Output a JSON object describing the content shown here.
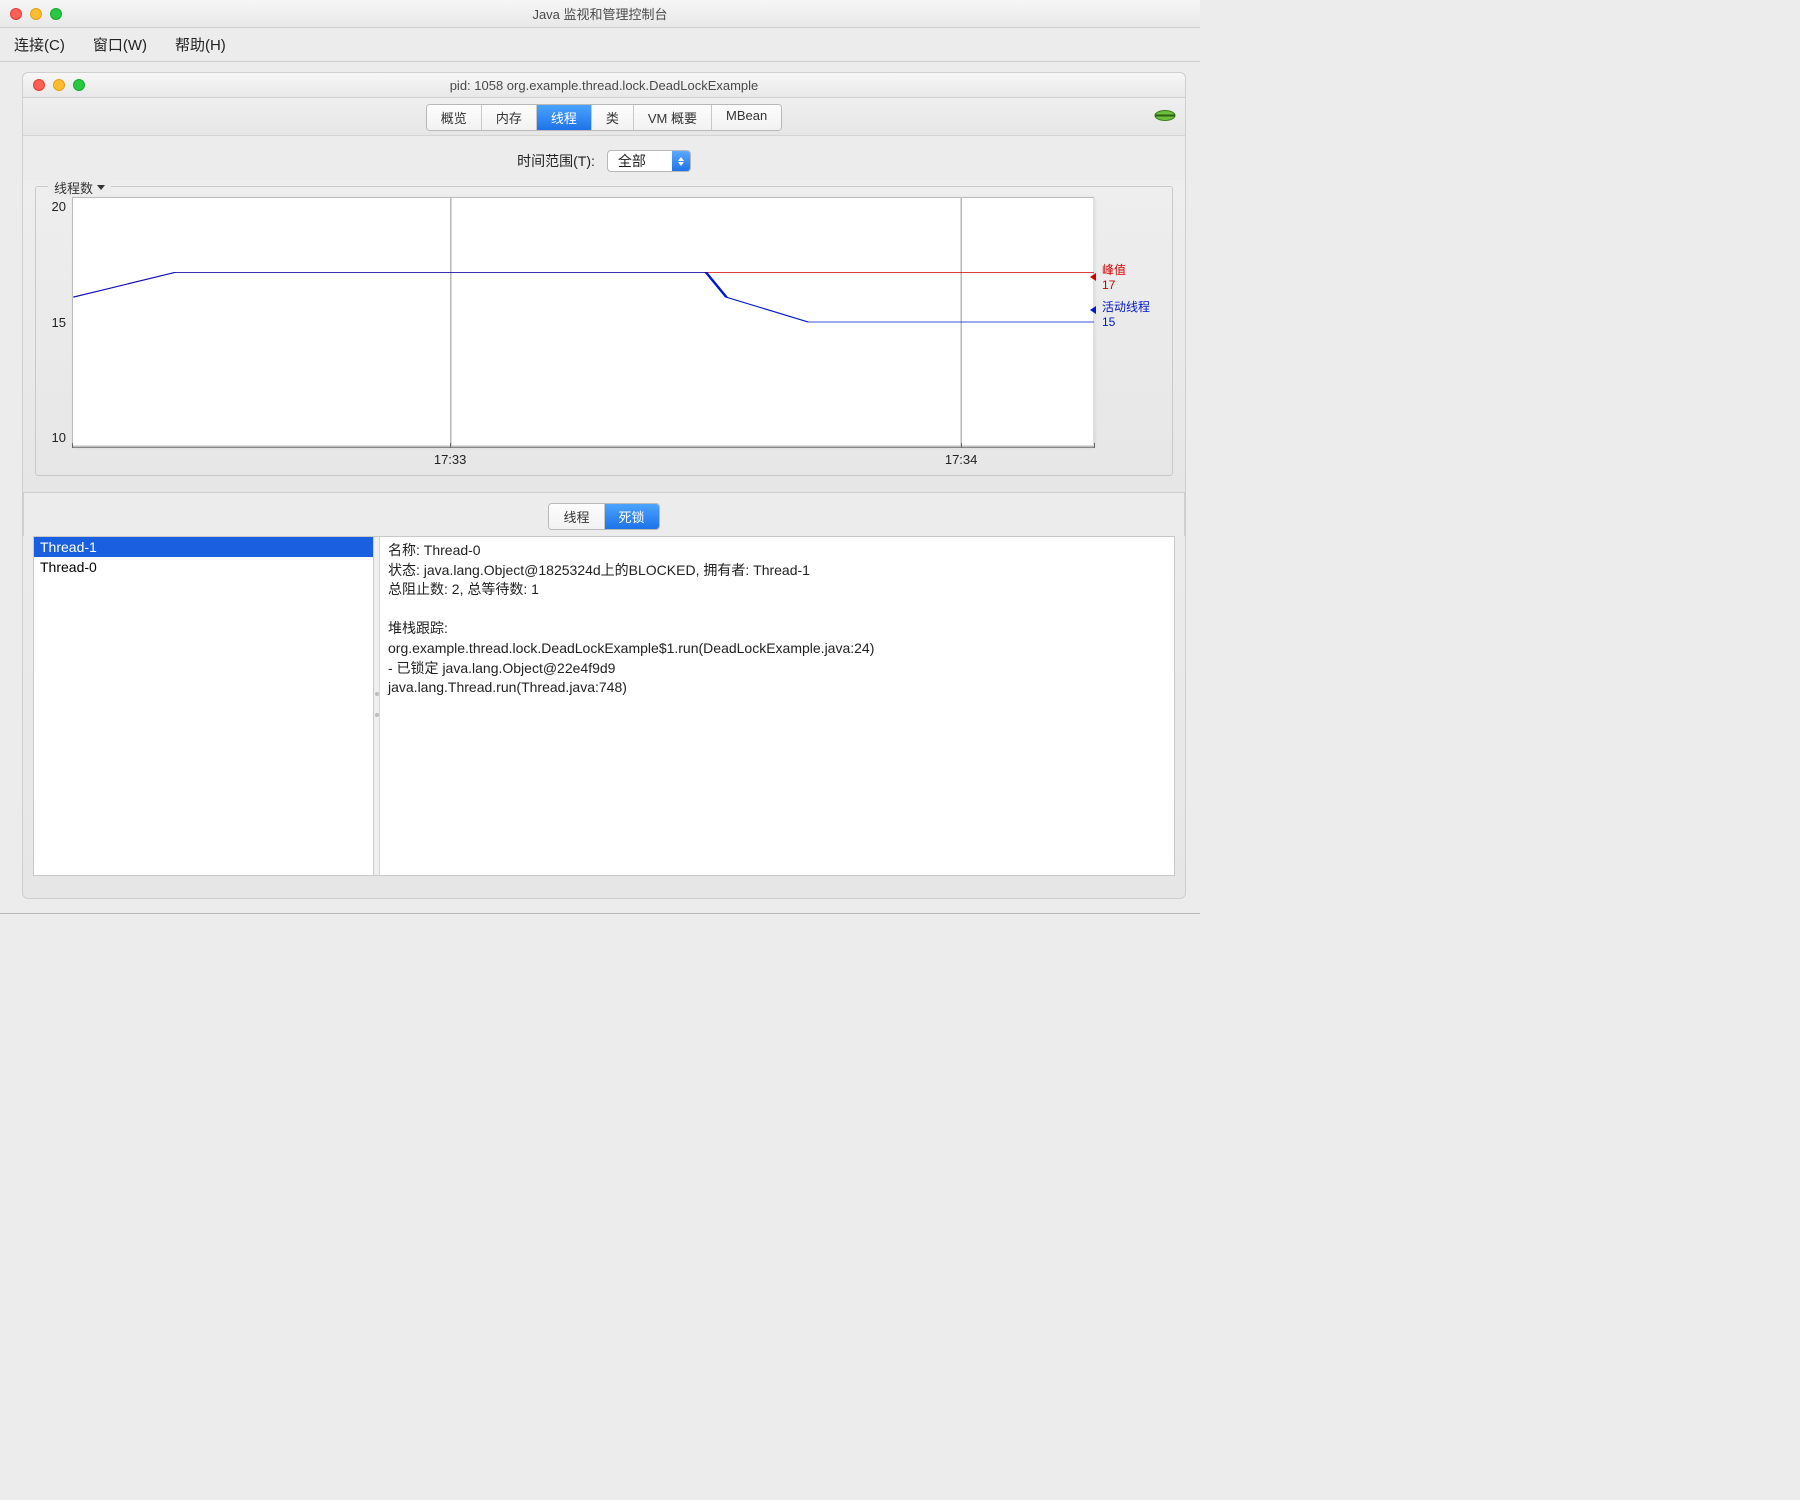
{
  "app_title": "Java 监视和管理控制台",
  "menubar": {
    "connect": "连接(C)",
    "window": "窗口(W)",
    "help": "帮助(H)"
  },
  "inner_title": "pid: 1058 org.example.thread.lock.DeadLockExample",
  "tabs": {
    "overview": "概览",
    "memory": "内存",
    "threads": "线程",
    "classes": "类",
    "vm": "VM 概要",
    "mbean": "MBean"
  },
  "time_range": {
    "label": "时间范围(T):",
    "value": "全部"
  },
  "chart_title": "线程数",
  "chart_data": {
    "type": "line",
    "x_ticks": [
      "17:33",
      "17:34"
    ],
    "ylim": [
      10,
      20
    ],
    "y_ticks": [
      20,
      15,
      10
    ],
    "series": [
      {
        "name": "峰值",
        "value_label": "17",
        "color": "#d40000",
        "points": [
          [
            0,
            16
          ],
          [
            10,
            17
          ],
          [
            100,
            17
          ]
        ]
      },
      {
        "name": "活动线程",
        "value_label": "15",
        "color": "#0018c8",
        "points": [
          [
            0,
            16
          ],
          [
            10,
            17
          ],
          [
            62,
            17
          ],
          [
            64,
            16
          ],
          [
            72,
            15
          ],
          [
            100,
            15
          ]
        ]
      }
    ],
    "peak_label": "峰值",
    "peak_value": "17",
    "live_label": "活动线程",
    "live_value": "15"
  },
  "sub_tabs": {
    "threads": "线程",
    "deadlock": "死锁"
  },
  "thread_list": [
    "Thread-1",
    "Thread-0"
  ],
  "detail": {
    "name_line": "名称: Thread-0",
    "state_line": "状态: java.lang.Object@1825324d上的BLOCKED, 拥有者: Thread-1",
    "blocked_line": "总阻止数: 2, 总等待数: 1",
    "stack_header": "堆栈跟踪:",
    "stack1": "org.example.thread.lock.DeadLockExample$1.run(DeadLockExample.java:24)",
    "stack2": "   - 已锁定 java.lang.Object@22e4f9d9",
    "stack3": "java.lang.Thread.run(Thread.java:748)"
  }
}
